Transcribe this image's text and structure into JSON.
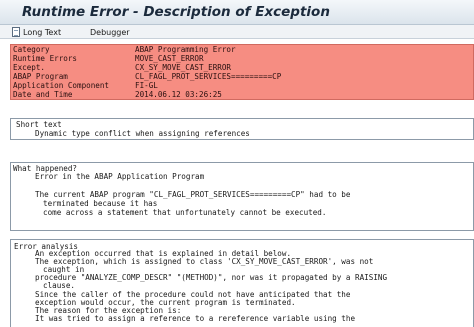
{
  "window": {
    "title": "Runtime Error - Description of Exception"
  },
  "toolbar": {
    "long_text": "Long Text",
    "debugger": "Debugger"
  },
  "info": [
    {
      "key": "Category",
      "value": "ABAP Programming Error"
    },
    {
      "key": "Runtime Errors",
      "value": "MOVE_CAST_ERROR"
    },
    {
      "key": "Except.",
      "value": "CX_SY_MOVE_CAST_ERROR"
    },
    {
      "key": "ABAP Program",
      "value": "CL_FAGL_PROT_SERVICES=========CP"
    },
    {
      "key": "Application Component",
      "value": "FI-GL"
    },
    {
      "key": "Date and Time",
      "value": "2014.06.12 03:26:25"
    }
  ],
  "short_text": {
    "title": "Short text",
    "lines": [
      "Dynamic type conflict when assigning references"
    ]
  },
  "what_happened": {
    "title": "What happened?",
    "lines": [
      "Error in the ABAP Application Program",
      "",
      "The current ABAP program \"CL_FAGL_PROT_SERVICES=========CP\" had to be",
      "terminated because it has",
      "come across a statement that unfortunately cannot be executed."
    ]
  },
  "error_analysis": {
    "title": "Error analysis",
    "lines": [
      "An exception occurred that is explained in detail below.",
      "The exception, which is assigned to class 'CX_SY_MOVE_CAST_ERROR', was not",
      "caught in",
      "procedure \"ANALYZE_COMP_DESCR\" \"(METHOD)\", nor was it propagated by a RAISING",
      "clause.",
      "Since the caller of the procedure could not have anticipated that the",
      "exception would occur, the current program is terminated.",
      "The reason for the exception is:",
      "It was tried to assign a reference to a rereference variable using the"
    ]
  }
}
